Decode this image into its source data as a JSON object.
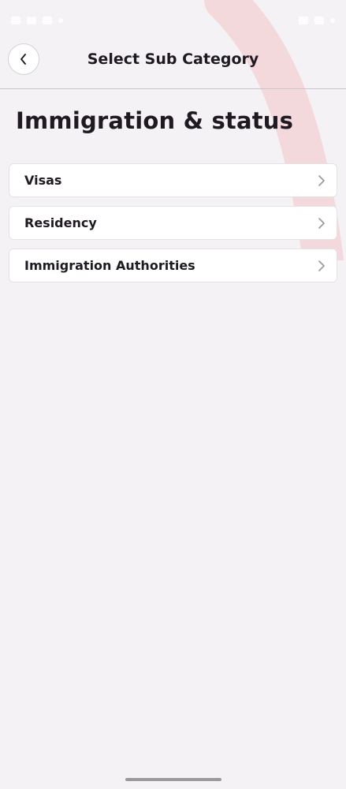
{
  "header": {
    "title": "Select Sub Category"
  },
  "page": {
    "title": "Immigration & status"
  },
  "sub_categories": [
    {
      "label": "Visas"
    },
    {
      "label": "Residency"
    },
    {
      "label": "Immigration Authorities"
    }
  ],
  "icons": {
    "back": "chevron-left-icon",
    "item_arrow": "chevron-right-icon"
  },
  "colors": {
    "background": "#f4f2f5",
    "accent_arc": "#f3d6d9",
    "card": "#ffffff",
    "text": "#1f1a22"
  }
}
